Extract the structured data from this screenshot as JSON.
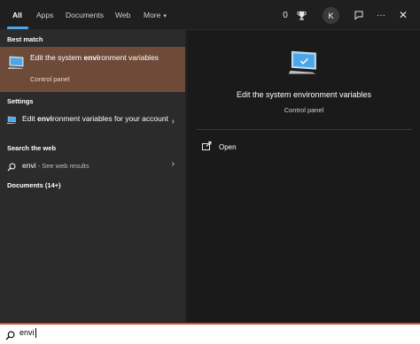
{
  "tabs": [
    {
      "label": "All"
    },
    {
      "label": "Apps"
    },
    {
      "label": "Documents"
    },
    {
      "label": "Web"
    },
    {
      "label": "More"
    }
  ],
  "topbar": {
    "points": "0",
    "avatar_initial": "K"
  },
  "left": {
    "best_match_heading": "Best match",
    "best_match": {
      "title_prefix": "Edit the system ",
      "title_bold": "envi",
      "title_suffix": "ronment variables",
      "subtitle": "Control panel"
    },
    "settings_heading": "Settings",
    "settings_item": {
      "prefix": "Edit ",
      "bold": "envi",
      "suffix": "ronment variables for your account"
    },
    "web_heading": "Search the web",
    "web_item": {
      "query": "envi",
      "suffix": " - See web results"
    },
    "documents_heading": "Documents (14+)"
  },
  "right": {
    "title": "Edit the system environment variables",
    "subtitle": "Control panel",
    "action_open": "Open"
  },
  "search": {
    "value": "envi"
  },
  "colors": {
    "accent_tab": "#4ea5e8",
    "best_match_bg": "#6e4a39",
    "search_border": "#c8512e"
  },
  "icons": [
    "trophy-icon",
    "feedback-icon",
    "more-icon",
    "close-icon",
    "monitor-icon",
    "search-icon",
    "open-icon",
    "chevron-right-icon"
  ]
}
